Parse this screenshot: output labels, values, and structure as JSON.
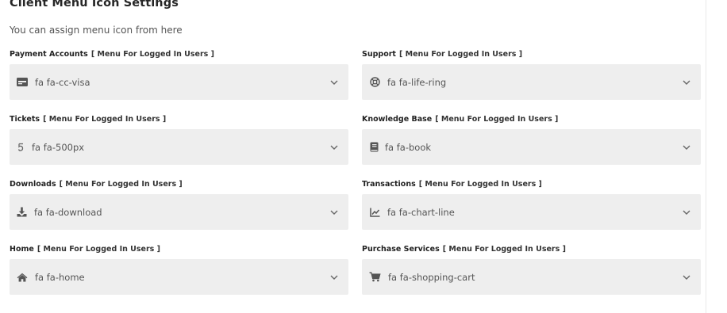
{
  "header": {
    "title": "Client Menu Icon Settings",
    "subtitle": "You can assign menu icon from here"
  },
  "hint_text": "[ Menu For Logged In Users ]",
  "fields": [
    {
      "label": "Payment Accounts",
      "value": "fa fa-cc-visa",
      "icon": "cc-visa-icon"
    },
    {
      "label": "Support",
      "value": "fa fa-life-ring",
      "icon": "life-ring-icon"
    },
    {
      "label": "Tickets",
      "value": "fa fa-500px",
      "icon": "500px-icon"
    },
    {
      "label": "Knowledge Base",
      "value": "fa fa-book",
      "icon": "book-icon"
    },
    {
      "label": "Downloads",
      "value": "fa fa-download",
      "icon": "download-icon"
    },
    {
      "label": "Transactions",
      "value": "fa fa-chart-line",
      "icon": "chart-line-icon"
    },
    {
      "label": "Home",
      "value": "fa fa-home",
      "icon": "home-icon"
    },
    {
      "label": "Purchase Services",
      "value": "fa fa-shopping-cart",
      "icon": "shopping-cart-icon"
    }
  ],
  "colors": {
    "select_bg": "#eeeeee",
    "text_muted": "#555555"
  }
}
